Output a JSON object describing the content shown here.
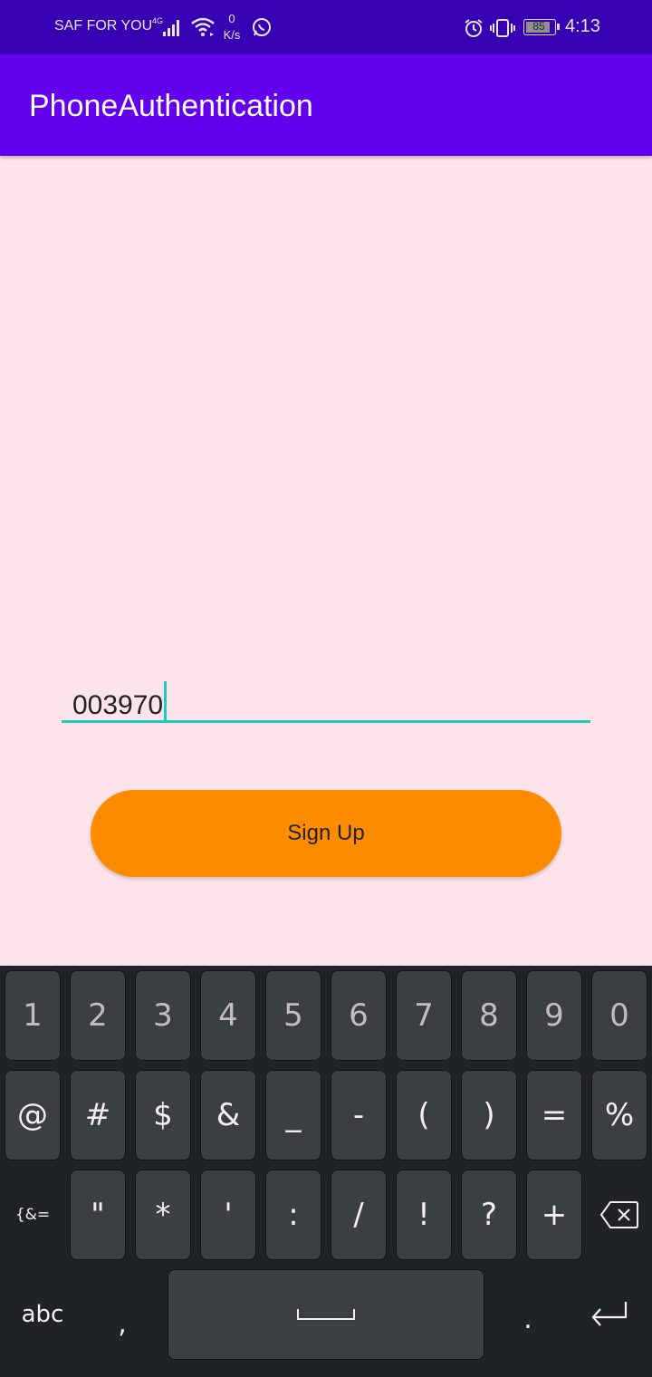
{
  "status_bar": {
    "carrier": "SAF FOR YOU",
    "network": "4G",
    "speed_value": "0",
    "speed_unit": "K/s",
    "battery": "85",
    "time": "4:13"
  },
  "app_bar": {
    "title": "PhoneAuthentication"
  },
  "form": {
    "phone_value": "003970",
    "signup_label": "Sign Up"
  },
  "keyboard": {
    "row1": [
      "1",
      "2",
      "3",
      "4",
      "5",
      "6",
      "7",
      "8",
      "9",
      "0"
    ],
    "row2": [
      "@",
      "#",
      "$",
      "&",
      "_",
      "-",
      "(",
      ")",
      "=",
      "%"
    ],
    "row3_left": "{&=",
    "row3": [
      "\"",
      "*",
      "'",
      ":",
      "/",
      "!",
      "?",
      "+"
    ],
    "abc_label": "abc",
    "comma": ",",
    "period": "."
  },
  "colors": {
    "status_bar": "#3700b3",
    "app_bar": "#6200ee",
    "background": "#fde4ea",
    "accent": "#1ec9c0",
    "button": "#ff8c00",
    "keyboard_bg": "#1f2227",
    "key_bg": "#3b3e43"
  }
}
